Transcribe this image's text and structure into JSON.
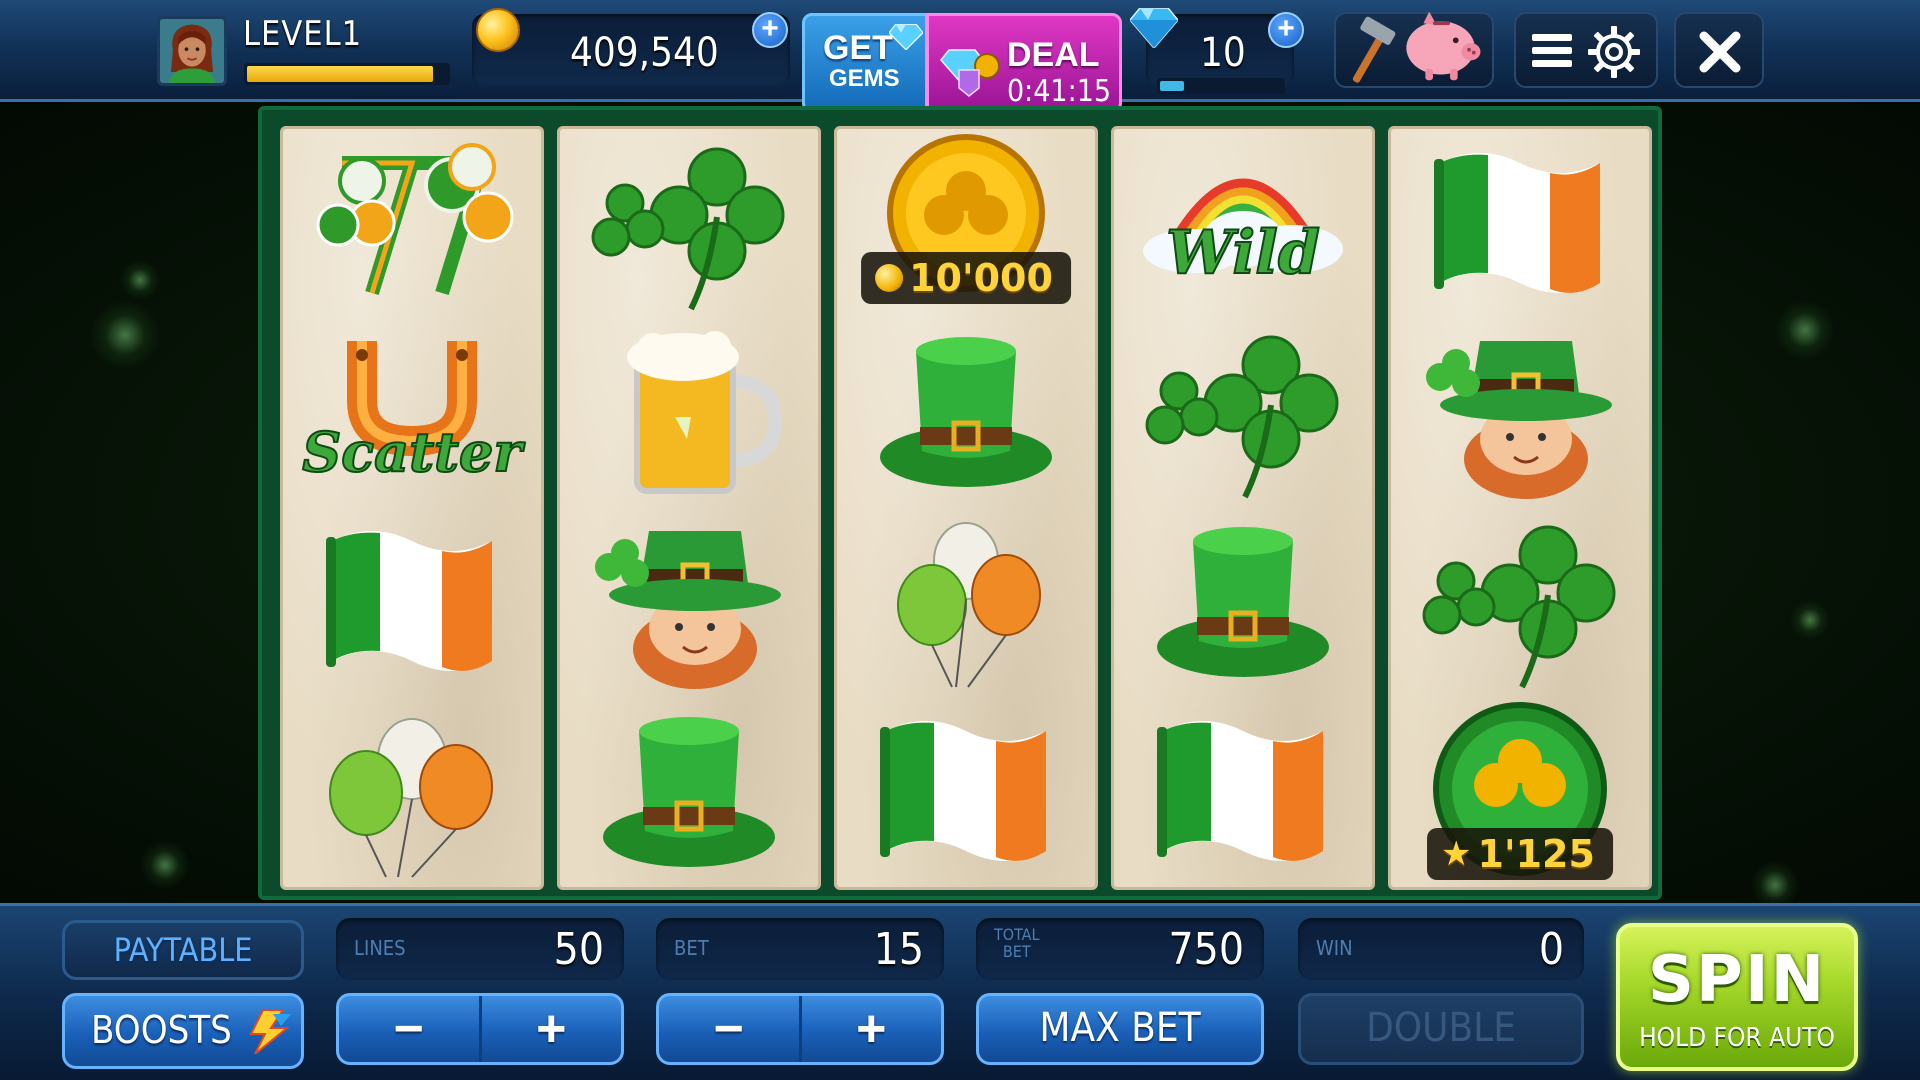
{
  "topbar": {
    "level_label": "LEVEL1",
    "xp_progress": 0.93,
    "coins": "409,540",
    "get_gems": {
      "line1": "GET",
      "line2": "GEMS"
    },
    "deal": {
      "label": "DEAL",
      "timer": "0:41:15"
    },
    "gems": "10",
    "gem_progress": 0.2,
    "icons": [
      "avatar",
      "coin-icon",
      "add-coins-plus-icon",
      "gem-icon",
      "add-gems-plus-icon",
      "hammer-piggy-bank-icon",
      "menu-icon",
      "gear-icon",
      "close-icon"
    ]
  },
  "reels": [
    {
      "symbols": [
        "sevens-shamrock",
        "horseshoe-scatter",
        "irish-flag",
        "balloons"
      ]
    },
    {
      "symbols": [
        "four-leaf-clover",
        "beer-mug",
        "leprechaun",
        "top-hat"
      ]
    },
    {
      "symbols": [
        "gold-coin-jackpot",
        "top-hat",
        "balloons",
        "irish-flag"
      ]
    },
    {
      "symbols": [
        "rainbow-wild",
        "four-leaf-clover",
        "top-hat",
        "irish-flag"
      ]
    },
    {
      "symbols": [
        "irish-flag",
        "leprechaun",
        "four-leaf-clover",
        "green-coin-bonus"
      ]
    }
  ],
  "symbol_text": {
    "scatter": "Scatter",
    "wild": "Wild",
    "jackpot_value": "10'000",
    "bonus_value": "1'125"
  },
  "bottombar": {
    "paytable": "PAYTABLE",
    "boosts": "BOOSTS",
    "lines_label": "LINES",
    "lines_value": "50",
    "bet_label": "BET",
    "bet_value": "15",
    "total_bet_label_1": "TOTAL",
    "total_bet_label_2": "BET",
    "total_bet_value": "750",
    "win_label": "WIN",
    "win_value": "0",
    "minus": "−",
    "plus": "+",
    "max_bet": "MAX BET",
    "double": "DOUBLE",
    "spin": "SPIN",
    "spin_sub": "HOLD FOR AUTO"
  },
  "colors": {
    "accent_blue": "#1a60b8",
    "spin_green": "#a6d82a",
    "deal_magenta": "#c826b4",
    "reel_frame_green": "#0b4a2a",
    "gold": "#ffd43b"
  }
}
